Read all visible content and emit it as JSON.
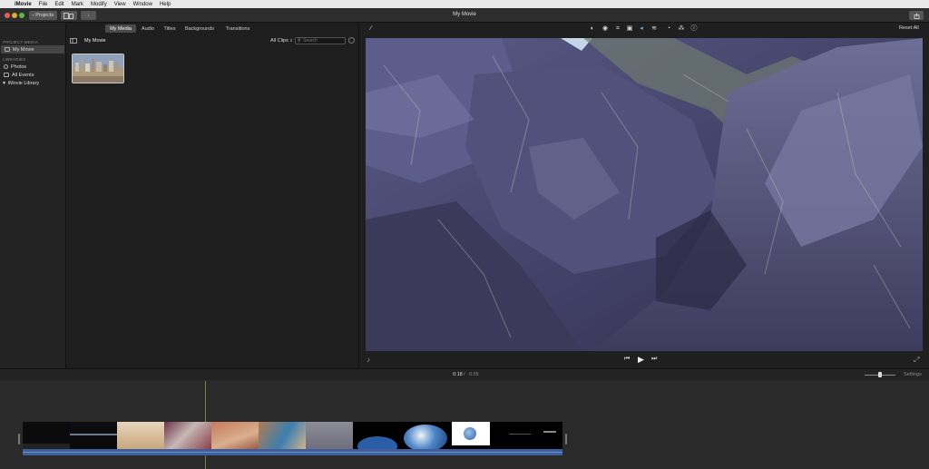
{
  "menubar": {
    "app": "iMovie",
    "items": [
      "File",
      "Edit",
      "Mark",
      "Modify",
      "View",
      "Window",
      "Help"
    ]
  },
  "toolbar": {
    "projects_label": "Projects",
    "window_title": "My Movie"
  },
  "sidebar": {
    "project_media_heading": "PROJECT MEDIA",
    "project_item": "My Movie",
    "libraries_heading": "LIBRARIES",
    "library_items": [
      "Photos",
      "All Events",
      "iMovie Library"
    ]
  },
  "browser": {
    "tabs": [
      "My Media",
      "Audio",
      "Titles",
      "Backgrounds",
      "Transitions"
    ],
    "active_tab": "My Media",
    "heading": "My Movie",
    "filter": "All Clips",
    "search_placeholder": "Search"
  },
  "viewer": {
    "reset_label": "Reset All",
    "current_time": "0:18",
    "total_time": "0:55",
    "settings_label": "Settings"
  },
  "colors": {
    "accent": "#6c8a32",
    "audio": "#3e5f9a",
    "selection": "#454545"
  }
}
